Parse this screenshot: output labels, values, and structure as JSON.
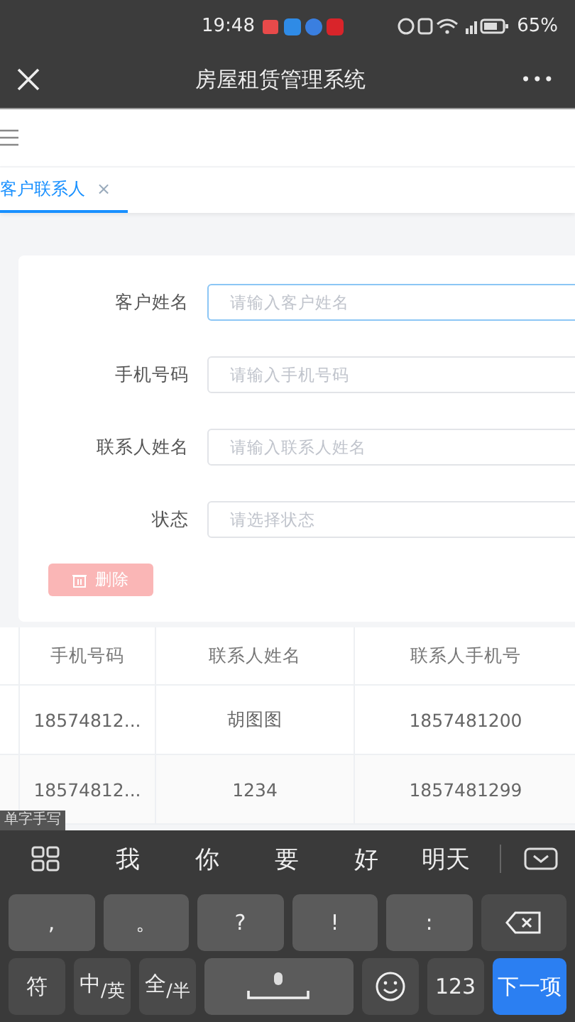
{
  "status_bar": {
    "time": "19:48",
    "battery": "65%"
  },
  "app_bar": {
    "title": "房屋租赁管理系统",
    "menu": "•••"
  },
  "tabs": [
    {
      "label": "客户联系人",
      "selected": true,
      "close": "×"
    }
  ],
  "form": {
    "fields": [
      {
        "label": "客户姓名",
        "placeholder": "请输入客户姓名",
        "focused": true
      },
      {
        "label": "手机号码",
        "placeholder": "请输入手机号码",
        "focused": false
      },
      {
        "label": "联系人姓名",
        "placeholder": "请输入联系人姓名",
        "focused": false
      },
      {
        "label": "状态",
        "placeholder": "请选择状态",
        "focused": false
      }
    ],
    "delete_button": {
      "label": "删除",
      "disabled": true
    }
  },
  "table": {
    "columns": [
      "手机号码",
      "联系人姓名",
      "联系人手机号"
    ],
    "rows": [
      {
        "cells": [
          "18574812...",
          "胡图图",
          "1857481200"
        ]
      },
      {
        "cells": [
          "18574812...",
          "1234",
          "1857481299"
        ]
      }
    ]
  },
  "keyboard": {
    "mode_tag": "单字手写",
    "candidates": [
      "我",
      "你",
      "要",
      "好",
      "明天"
    ],
    "rows": [
      [
        {
          "kind": "char",
          "label": ","
        },
        {
          "kind": "char",
          "label": "。"
        },
        {
          "kind": "char",
          "label": "?"
        },
        {
          "kind": "char",
          "label": "!"
        },
        {
          "kind": "char",
          "label": ":"
        },
        {
          "kind": "backspace"
        }
      ],
      [
        {
          "kind": "func",
          "label": "符"
        },
        {
          "kind": "func",
          "label": "中$_{/英}$"
        },
        {
          "kind": "func",
          "label": "全$_{/半}$"
        },
        {
          "kind": "space"
        },
        {
          "kind": "emoji"
        },
        {
          "kind": "func",
          "label": "123"
        },
        {
          "kind": "action",
          "label": "下一项"
        }
      ]
    ]
  }
}
